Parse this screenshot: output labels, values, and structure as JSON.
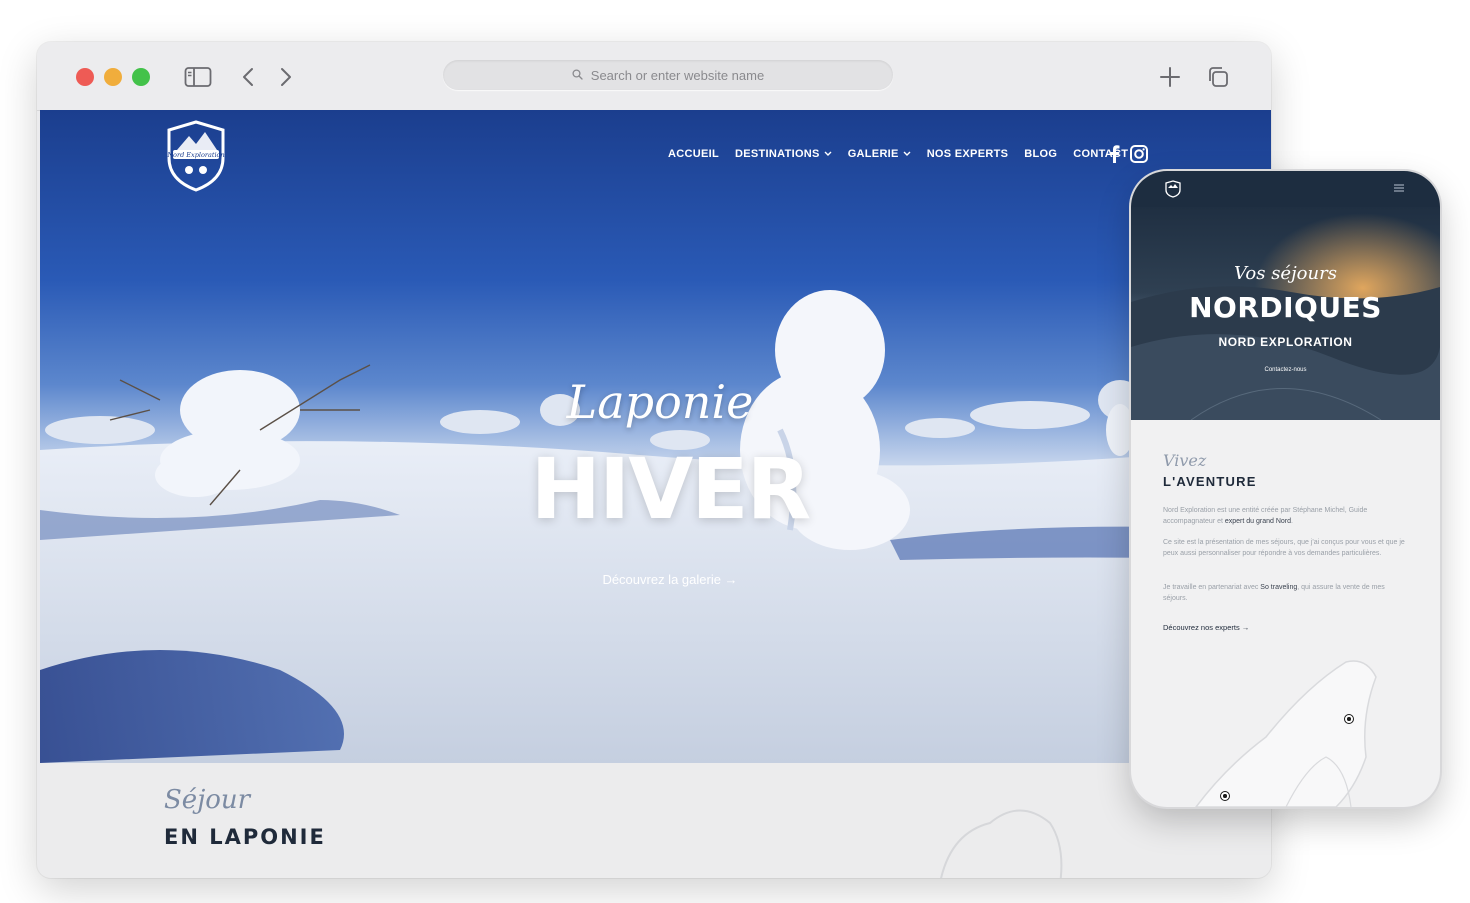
{
  "browser": {
    "address_placeholder": "Search or enter website name"
  },
  "site": {
    "logo_text": "Nord Exploration",
    "nav": {
      "accueil": "ACCUEIL",
      "destinations": "DESTINATIONS",
      "galerie": "GALERIE",
      "nos_experts": "NOS EXPERTS",
      "blog": "BLOG",
      "contact": "CONTACT"
    },
    "hero": {
      "script": "Laponie",
      "title": "HIVER",
      "cta": "Découvrez la galerie →"
    },
    "section": {
      "script": "Séjour",
      "title": "EN LAPONIE"
    }
  },
  "phone": {
    "hero": {
      "script": "Vos séjours",
      "title": "NORDIQUES",
      "subtitle": "NORD EXPLORATION",
      "cta": "Contactez-nous"
    },
    "intro": {
      "script": "Vivez",
      "title": "L'AVENTURE",
      "p1_a": "Nord Exploration est une entité créée par Stéphane Michel, Guide accompagnateur et ",
      "p1_b": "expert du grand Nord",
      "p1_c": ".",
      "p2": "Ce site est la présentation de mes séjours, que j'ai conçus pour vous et que je peux aussi personnaliser pour répondre à vos demandes particulières.",
      "p3_a": "Je travaille en partenariat avec ",
      "p3_b": "So traveling",
      "p3_c": ", qui assure la vente de mes séjours.",
      "link": "Découvrez nos experts →"
    }
  },
  "colors": {
    "sky_top": "#1b3e8e",
    "snow": "#e6ecf6",
    "dark_navy": "#1f2a3a",
    "phone_header": "#1d2d40",
    "traffic_red": "#ee5b55",
    "traffic_yellow": "#f0ad3c",
    "traffic_green": "#43c24a"
  }
}
